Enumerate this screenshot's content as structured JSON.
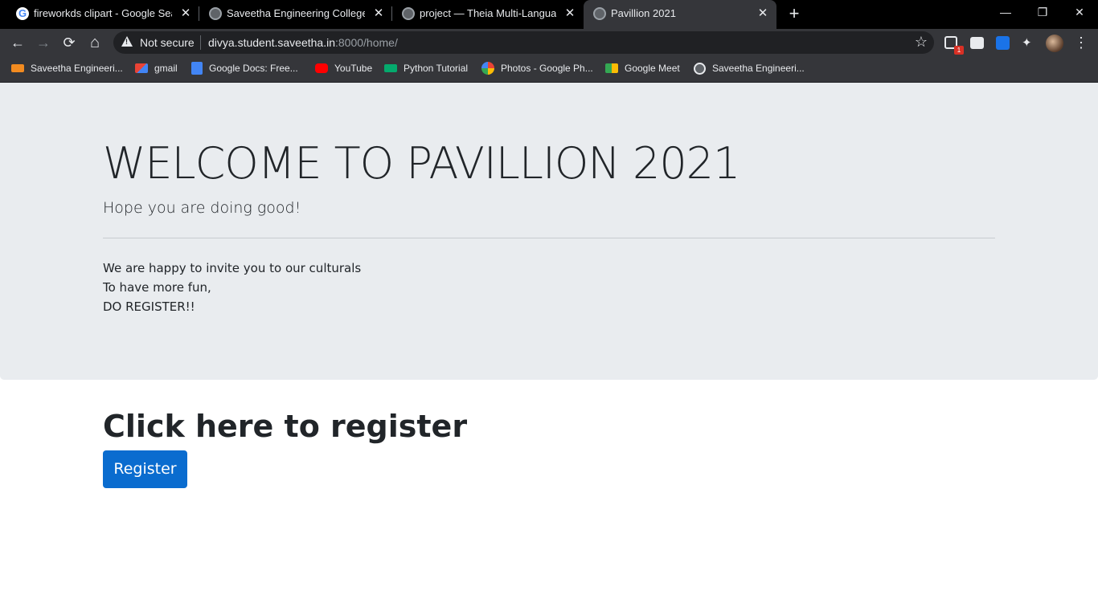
{
  "browser": {
    "tabs": [
      {
        "title": "fireworkds clipart - Google Search",
        "active": false,
        "icon": "google-icon"
      },
      {
        "title": "Saveetha Engineering College",
        "active": false,
        "icon": "globe-icon"
      },
      {
        "title": "project — Theia Multi-Language Workspace",
        "active": false,
        "icon": "globe-icon"
      },
      {
        "title": "Pavillion 2021",
        "active": true,
        "icon": "globe-icon"
      }
    ],
    "new_tab": "+",
    "window_controls": {
      "minimize": "—",
      "restore": "❐",
      "close": "✕"
    },
    "toolbar": {
      "back": "←",
      "forward": "→",
      "reload": "⟳",
      "home": "⌂",
      "security_label": "Not secure",
      "url_host": "divya.student.saveetha.in",
      "url_rest": ":8000/home/",
      "star": "☆",
      "extension_badge": "1",
      "menu": "⋮"
    },
    "bookmarks": [
      {
        "label": "Saveetha Engineeri...",
        "icon": "saveetha-icon"
      },
      {
        "label": "gmail",
        "icon": "gmail-icon"
      },
      {
        "label": "Google Docs: Free...",
        "icon": "docs-icon"
      },
      {
        "label": "YouTube",
        "icon": "youtube-icon"
      },
      {
        "label": "Python Tutorial",
        "icon": "w3schools-icon"
      },
      {
        "label": "Photos - Google Ph...",
        "icon": "photos-icon"
      },
      {
        "label": "Google Meet",
        "icon": "meet-icon"
      },
      {
        "label": "Saveetha Engineeri...",
        "icon": "globe-icon"
      }
    ]
  },
  "page": {
    "title": "WELCOME TO PAVILLION 2021",
    "lead": "Hope you are doing good!",
    "invite_lines": [
      "We are happy to invite you to our culturals",
      "To have more fun,",
      "DO REGISTER!!"
    ],
    "register_heading": "Click here to register",
    "register_button": "Register"
  },
  "colors": {
    "jumbotron_bg": "#e9ecef",
    "button_bg": "#0a6ccf",
    "text": "#212529",
    "chrome_dark": "#35363a"
  }
}
